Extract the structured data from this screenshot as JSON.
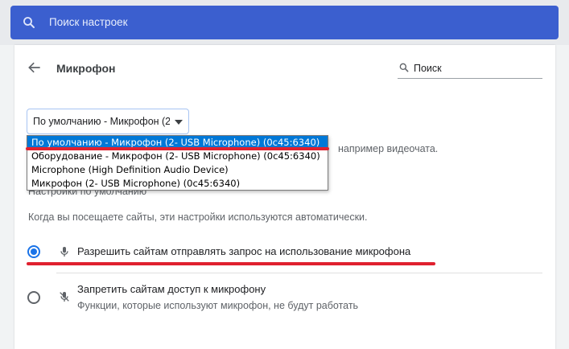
{
  "search": {
    "placeholder": "Поиск настроек"
  },
  "header": {
    "title": "Микрофон",
    "search_placeholder": "Поиск"
  },
  "device_select": {
    "selected": "По умолчанию - Микрофон (2- USB Microphone) (0c45:6340)",
    "options": [
      "По умолчанию - Микрофон (2- USB Microphone) (0c45:6340)",
      "Оборудование - Микрофон (2- USB Microphone) (0c45:6340)",
      "Microphone (High Definition Audio Device)",
      "Микрофон (2- USB Microphone) (0c45:6340)"
    ]
  },
  "hint_text": "например видеочата.",
  "defaults": {
    "title": "Настройки по умолчанию",
    "description": "Когда вы посещаете сайты, эти настройки используются автоматически."
  },
  "options": [
    {
      "label": "Разрешить сайтам отправлять запрос на использование микрофона",
      "checked": true,
      "icon": "mic-icon"
    },
    {
      "label": "Запретить сайтам доступ к микрофону",
      "sublabel": "Функции, которые используют микрофон, не будут работать",
      "checked": false,
      "icon": "mic-off-icon"
    }
  ],
  "colors": {
    "accent": "#1a73e8",
    "search_bar": "#3b5fcf",
    "annotation": "#e0212f",
    "dropdown_highlight": "#0078d7"
  }
}
